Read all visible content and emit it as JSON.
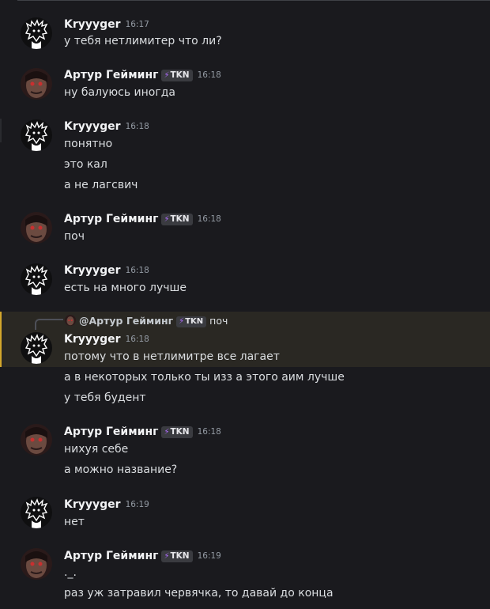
{
  "users": {
    "kr": {
      "name": "Krуyyger"
    },
    "ar": {
      "name": "Артур Гейминг",
      "tag": "TKN"
    }
  },
  "messages": [
    {
      "user": "Krуyyger",
      "time": "16:17",
      "lines": [
        "у тебя нетлимитер что ли?"
      ]
    },
    {
      "user": "Артур Гейминг",
      "tag": "TKN",
      "time": "16:18",
      "lines": [
        "ну балуюсь иногда"
      ]
    },
    {
      "user": "Krуyyger",
      "time": "16:18",
      "lines": [
        "понятно",
        "это кал",
        "а не лагсвич"
      ]
    },
    {
      "user": "Артур Гейминг",
      "tag": "TKN",
      "time": "16:18",
      "lines": [
        "поч"
      ]
    },
    {
      "user": "Krуyyger",
      "time": "16:18",
      "lines": [
        "есть на много лучше"
      ]
    },
    {
      "user": "Krуyyger",
      "time": "16:18",
      "lines": [
        "потому что в нетлимитре все лагает",
        "а в некоторых только ты изз а этого аим лучше",
        "у тебя будент"
      ]
    },
    {
      "user": "Артур Гейминг",
      "tag": "TKN",
      "time": "16:18",
      "lines": [
        "нихуя себе",
        "а можно название?"
      ]
    },
    {
      "user": "Krуyyger",
      "time": "16:19",
      "lines": [
        "нет"
      ]
    },
    {
      "user": "Артур Гейминг",
      "tag": "TKN",
      "time": "16:19",
      "lines": [
        "._.",
        "раз уж затравил червячка, то давай до конца"
      ]
    }
  ],
  "reply": {
    "mention": "@Артур Гейминг",
    "tag": "TKN",
    "text": "поч"
  },
  "colors": {
    "background": "#1a1a1e",
    "reply_highlight": "#2a2823",
    "reply_border": "#d4a72c",
    "tag_bolt": "#b06cff"
  }
}
